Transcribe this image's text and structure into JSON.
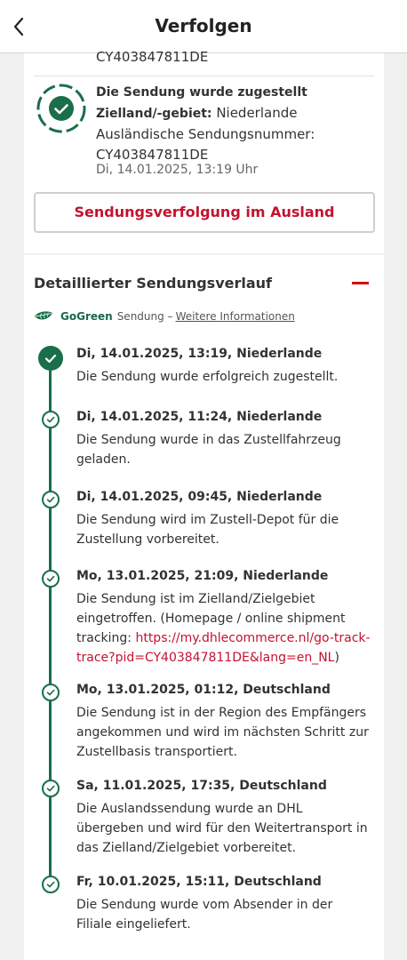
{
  "header": {
    "title": "Verfolgen"
  },
  "summary": {
    "prev_number": "CY403847811DE",
    "status": "Die Sendung wurde zugestellt",
    "destination_label": "Zielland/-gebiet:",
    "destination_value": "Niederlande",
    "foreign_number_label": "Ausländische Sendungsnummer:",
    "foreign_number": "CY403847811DE",
    "date": "Di, 14.01.2025, 13:19 Uhr",
    "abroad_button": "Sendungsverfolgung im Ausland"
  },
  "details": {
    "title": "Detaillierter Sendungsverlauf",
    "gogreen": "GoGreen",
    "sendung_label": "Sendung –",
    "more_info": "Weitere Informationen",
    "events": [
      {
        "date": "Di, 14.01.2025, 13:19, Niederlande",
        "desc": "Die Sendung wurde erfolgreich zugestellt."
      },
      {
        "date": "Di, 14.01.2025, 11:24, Niederlande",
        "desc": "Die Sendung wurde in das Zustellfahrzeug geladen."
      },
      {
        "date": "Di, 14.01.2025, 09:45, Niederlande",
        "desc": "Die Sendung wird im Zustell-Depot für die Zustellung vorbereitet."
      },
      {
        "date": "Mo, 13.01.2025, 21:09, Niederlande",
        "desc": "Die Sendung ist im Zielland/Zielgebiet eingetroffen. (Homepage / online shipment tracking: ",
        "link": "https://my.dhlecommerce.nl/go-track-trace?pid=CY403847811DE&lang=en_NL",
        "desc_end": ")"
      },
      {
        "date": "Mo, 13.01.2025, 01:12, Deutschland",
        "desc": "Die Sendung ist in der Region des Empfängers angekommen und wird im nächsten Schritt zur Zustellbasis transportiert."
      },
      {
        "date": "Sa, 11.01.2025, 17:35, Deutschland",
        "desc": "Die Auslandssendung wurde an DHL übergeben und wird für den Weitertransport in das Zielland/Zielgebiet vorbereitet."
      },
      {
        "date": "Fr, 10.01.2025, 15:11, Deutschland",
        "desc": "Die Sendung wurde vom Absender in der Filiale eingeliefert."
      }
    ]
  },
  "colors": {
    "accent_red": "#d40511",
    "link_red": "#c4122f",
    "green": "#1a6e4a"
  }
}
